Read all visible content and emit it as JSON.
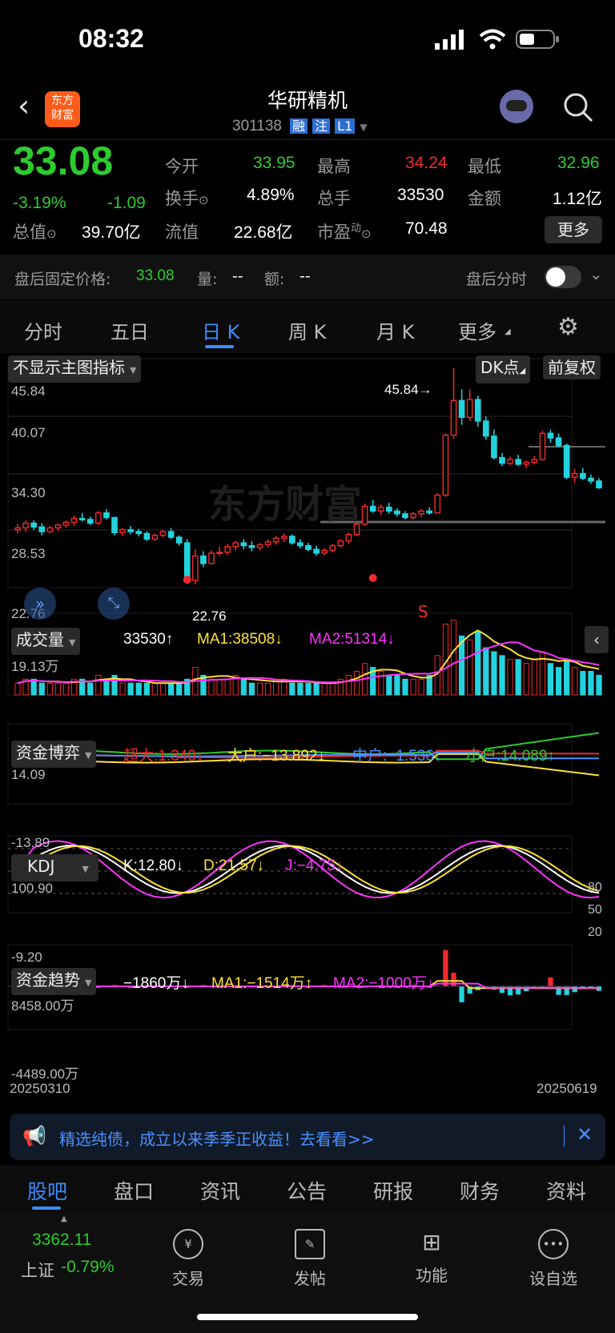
{
  "status": {
    "time": "08:32"
  },
  "header": {
    "logo_line1": "东方",
    "logo_line2": "财富",
    "stock_name": "华研精机",
    "stock_code": "301138",
    "badges": [
      "融",
      "注",
      "L1"
    ]
  },
  "quote": {
    "price": "33.08",
    "change_pct": "-3.19%",
    "change_amt": "-1.09",
    "open_label": "今开",
    "open": "33.95",
    "high_label": "最高",
    "high": "34.24",
    "low_label": "最低",
    "low": "32.96",
    "turnover_label": "换手",
    "turnover": "4.89%",
    "volume_label": "总手",
    "volume": "33530",
    "amount_label": "金额",
    "amount": "1.12亿",
    "mktcap_label": "总值",
    "mktcap": "39.70亿",
    "float_label": "流值",
    "float": "22.68亿",
    "pe_label": "市盈",
    "pe_sup": "动",
    "pe": "70.48",
    "more_button": "更多"
  },
  "after_hours": {
    "fixed_label": "盘后固定价格:",
    "fixed_price": "33.08",
    "qty_label": "量:",
    "qty": "--",
    "amt_label": "额:",
    "amt": "--",
    "timeshare_label": "盘后分时",
    "toggle_on": false
  },
  "tabs": {
    "items": [
      "分时",
      "五日",
      "日 K",
      "周 K",
      "月 K",
      "更多"
    ],
    "active": 2
  },
  "chart_toolbar": {
    "indicator": "不显示主图指标",
    "dk": "DK点",
    "adjust": "前复权"
  },
  "kline": {
    "price_labels": [
      "45.84",
      "40.07",
      "34.30",
      "28.53",
      "22.76"
    ],
    "max_label": "45.84→",
    "min_label": "22.76",
    "signal_s": "S",
    "watermark": "东方财富"
  },
  "volume": {
    "selector": "成交量",
    "value": "33530",
    "value_arrow": "↑",
    "ma1": "MA1:38508",
    "ma1_arrow": "↓",
    "ma2": "MA2:51314",
    "ma2_arrow": "↓",
    "top_label": "19.13万"
  },
  "fund": {
    "selector": "资金博弈",
    "super": "超大:1.340",
    "super_arrow": "↓",
    "large": "大户:−13.892",
    "large_arrow": "↓",
    "mid": "中户:−1.536",
    "mid_arrow": "↓",
    "small": "小户:14.089",
    "small_arrow": "↑",
    "top_label": "14.09",
    "bottom_label": "-13.89"
  },
  "kdj": {
    "selector": "KDJ",
    "k": "K:12.80",
    "k_arrow": "↓",
    "d": "D:21.57",
    "d_arrow": "↓",
    "j": "J:−4.75",
    "j_arrow": "↓",
    "top_label": "100.90",
    "bottom_label": "-9.20",
    "right_labels": [
      "80",
      "50",
      "20"
    ]
  },
  "trend": {
    "selector": "资金趋势",
    "value": "−1860万",
    "value_arrow": "↓",
    "ma1": "MA1:−1514万",
    "ma1_arrow": "↑",
    "ma2": "MA2:−1000万",
    "ma2_arrow": "↓",
    "top_label": "8458.00万",
    "bottom_label": "-4489.00万"
  },
  "dates": {
    "start": "20250310",
    "end": "20250619"
  },
  "banner": {
    "text": "精选纯债，成立以来季季正收益！去看看>>"
  },
  "bottom_tabs": {
    "items": [
      "股吧",
      "盘口",
      "资讯",
      "公告",
      "研报",
      "财务",
      "资料"
    ],
    "active": 0
  },
  "toolbar": {
    "index_value": "3362.11",
    "index_name": "上证",
    "index_change": "-0.79%",
    "items": [
      "交易",
      "发帖",
      "功能",
      "设自选"
    ],
    "icons": [
      "yen-icon",
      "edit-icon",
      "grid-icon",
      "more-icon"
    ]
  },
  "colors": {
    "up": "#f02a2a",
    "down": "#22d3de",
    "accent": "#3b8bff",
    "ma1": "#ffe133",
    "ma2": "#ff33ff"
  },
  "chart_data": {
    "type": "candlestick",
    "ohlc": [
      [
        28.6,
        29.2,
        28.2,
        28.8
      ],
      [
        28.8,
        29.6,
        28.4,
        29.3
      ],
      [
        29.3,
        29.6,
        28.6,
        28.9
      ],
      [
        28.9,
        29.3,
        28.0,
        28.4
      ],
      [
        28.4,
        29.0,
        28.2,
        28.8
      ],
      [
        28.8,
        29.3,
        28.5,
        29.1
      ],
      [
        29.1,
        29.6,
        28.8,
        29.4
      ],
      [
        29.4,
        30.1,
        29.0,
        29.8
      ],
      [
        29.8,
        30.4,
        29.5,
        29.7
      ],
      [
        29.7,
        30.0,
        29.1,
        29.3
      ],
      [
        29.3,
        30.6,
        29.1,
        30.4
      ],
      [
        30.4,
        30.8,
        29.7,
        29.9
      ],
      [
        29.9,
        30.0,
        28.0,
        28.3
      ],
      [
        28.3,
        28.8,
        27.9,
        28.6
      ],
      [
        28.6,
        29.0,
        28.1,
        28.4
      ],
      [
        28.4,
        28.7,
        27.9,
        28.2
      ],
      [
        28.2,
        28.4,
        27.4,
        27.6
      ],
      [
        27.6,
        28.2,
        27.4,
        28.0
      ],
      [
        28.0,
        28.6,
        27.8,
        28.4
      ],
      [
        28.4,
        28.8,
        27.6,
        27.8
      ],
      [
        27.8,
        28.0,
        26.9,
        27.2
      ],
      [
        27.2,
        27.6,
        22.8,
        23.2
      ],
      [
        23.2,
        26.5,
        22.76,
        25.8
      ],
      [
        25.8,
        26.3,
        24.6,
        25.0
      ],
      [
        25.0,
        26.4,
        24.9,
        26.1
      ],
      [
        26.1,
        26.8,
        25.8,
        26.2
      ],
      [
        26.2,
        27.1,
        25.9,
        26.8
      ],
      [
        26.8,
        27.4,
        26.4,
        27.2
      ],
      [
        27.2,
        27.6,
        26.5,
        26.9
      ],
      [
        26.9,
        27.4,
        26.3,
        26.7
      ],
      [
        26.7,
        27.2,
        26.4,
        27.0
      ],
      [
        27.0,
        27.6,
        26.7,
        27.3
      ],
      [
        27.3,
        27.9,
        27.0,
        27.7
      ],
      [
        27.7,
        28.2,
        27.3,
        27.9
      ],
      [
        27.9,
        28.1,
        27.0,
        27.2
      ],
      [
        27.2,
        27.6,
        26.6,
        26.9
      ],
      [
        26.9,
        27.2,
        26.3,
        26.5
      ],
      [
        26.5,
        26.9,
        25.8,
        26.1
      ],
      [
        26.1,
        26.6,
        25.9,
        26.4
      ],
      [
        26.4,
        27.1,
        26.2,
        26.9
      ],
      [
        26.9,
        27.6,
        26.7,
        27.4
      ],
      [
        27.4,
        28.3,
        27.1,
        28.1
      ],
      [
        28.1,
        29.4,
        27.9,
        29.2
      ],
      [
        29.2,
        31.4,
        29.0,
        31.1
      ],
      [
        31.1,
        31.8,
        30.4,
        30.6
      ],
      [
        30.6,
        31.3,
        30.2,
        31.0
      ],
      [
        31.0,
        31.5,
        30.3,
        30.6
      ],
      [
        30.6,
        30.9,
        30.0,
        30.3
      ],
      [
        30.3,
        30.6,
        29.7,
        29.9
      ],
      [
        29.9,
        30.5,
        29.7,
        30.3
      ],
      [
        30.3,
        30.8,
        29.9,
        30.6
      ],
      [
        30.6,
        31.0,
        30.2,
        30.4
      ],
      [
        30.4,
        32.5,
        30.3,
        32.3
      ],
      [
        32.3,
        38.9,
        32.1,
        38.7
      ],
      [
        38.7,
        45.84,
        38.3,
        42.4
      ],
      [
        42.4,
        43.6,
        39.8,
        40.6
      ],
      [
        40.6,
        43.6,
        40.2,
        42.5
      ],
      [
        42.5,
        42.9,
        39.6,
        40.2
      ],
      [
        40.2,
        40.7,
        38.2,
        38.6
      ],
      [
        38.6,
        39.3,
        36.1,
        36.3
      ],
      [
        36.3,
        36.8,
        35.4,
        35.7
      ],
      [
        35.7,
        36.4,
        35.5,
        36.1
      ],
      [
        36.1,
        36.6,
        35.4,
        35.6
      ],
      [
        35.6,
        36.0,
        35.2,
        35.8
      ],
      [
        35.8,
        36.5,
        35.6,
        36.1
      ],
      [
        36.1,
        39.2,
        36.0,
        38.9
      ],
      [
        38.9,
        39.3,
        37.9,
        38.4
      ],
      [
        38.4,
        38.9,
        37.4,
        37.6
      ],
      [
        37.6,
        37.8,
        34.0,
        34.2
      ],
      [
        34.2,
        35.1,
        33.6,
        34.6
      ],
      [
        34.6,
        35.2,
        33.9,
        34.1
      ],
      [
        34.1,
        34.5,
        33.5,
        33.8
      ],
      [
        33.8,
        34.1,
        32.96,
        33.08
      ]
    ],
    "volumes": [
      3,
      4,
      4,
      3,
      3,
      3,
      3,
      4,
      4,
      3,
      5,
      4,
      5,
      3,
      3,
      3,
      3,
      3,
      3,
      3,
      3,
      4,
      7,
      5,
      4,
      4,
      4,
      5,
      4,
      3,
      3,
      3,
      4,
      4,
      3,
      3,
      3,
      3,
      3,
      3,
      4,
      5,
      6,
      8,
      7,
      6,
      5,
      5,
      4,
      4,
      4,
      5,
      10,
      18,
      19,
      15,
      14,
      16,
      12,
      11,
      10,
      9,
      9,
      8,
      9,
      11,
      8,
      7,
      9,
      7,
      6,
      6,
      5
    ],
    "y_axis": [
      22.76,
      45.84
    ],
    "x_range": [
      "20250310",
      "20250619"
    ]
  }
}
